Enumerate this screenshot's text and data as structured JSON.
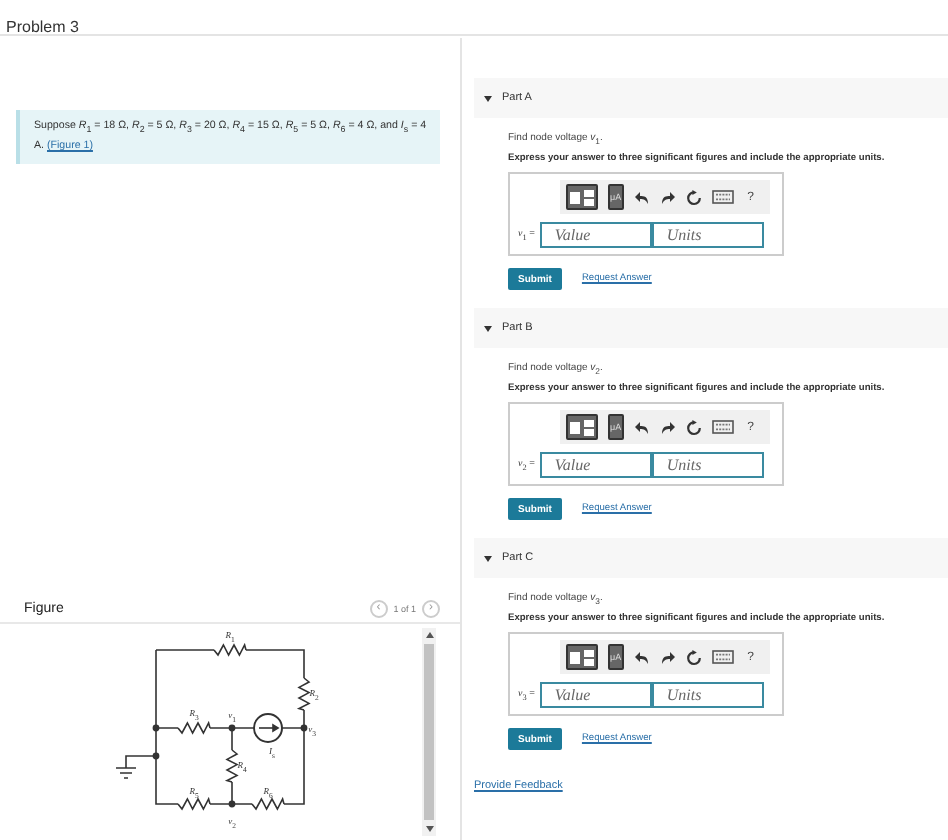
{
  "header": {
    "title": "Problem 3"
  },
  "problem": {
    "text": "Suppose *R*$_{1}$ = 18 Ω, *R*$_{2}$ = 5 Ω, *R*$_{3}$ = 20 Ω, *R*$_{4}$ = 15 Ω, *R*$_{5}$ = 5 Ω, *R*$_{6}$ = 4 Ω, and *I*$_{s}$ = 4 A.",
    "link": "(Figure 1)"
  },
  "figure": {
    "title": "Figure",
    "pager": {
      "prev": "‹",
      "label": "1 of 1",
      "next": "›"
    },
    "labels": [
      "*R*$_{1}$",
      "*R*$_{2}$",
      "*R*$_{3}$",
      "*v*$_{1}$",
      "*v*$_{3}$",
      "*I*$_{s}$",
      "*R*$_{4}$",
      "*R*$_{5}$",
      "*R*$_{6}$",
      "*v*$_{2}$"
    ]
  },
  "parts": [
    {
      "title": "Part A",
      "expanded": true,
      "prompt": "Find node voltage *v*$_{1}$.",
      "instruction": "Express your answer to three significant figures and include the appropriate units.",
      "units_tool": "μA",
      "help": "?",
      "variable": "*v*$_{1}$ =",
      "value_placeholder": "Value",
      "units_placeholder": "Units",
      "submit": "Submit",
      "request": "Request Answer"
    },
    {
      "title": "Part B",
      "expanded": true,
      "prompt": "Find node voltage *v*$_{2}$.",
      "instruction": "Express your answer to three significant figures and include the appropriate units.",
      "units_tool": "μA",
      "help": "?",
      "variable": "*v*$_{2}$ =",
      "value_placeholder": "Value",
      "units_placeholder": "Units",
      "submit": "Submit",
      "request": "Request Answer"
    },
    {
      "title": "Part C",
      "expanded": true,
      "prompt": "Find node voltage *v*$_{3}$.",
      "instruction": "Express your answer to three significant figures and include the appropriate units.",
      "units_tool": "μA",
      "help": "?",
      "variable": "*v*$_{3}$ =",
      "value_placeholder": "Value",
      "units_placeholder": "Units",
      "submit": "Submit",
      "request": "Request Answer"
    }
  ],
  "feedback": "Provide Feedback"
}
